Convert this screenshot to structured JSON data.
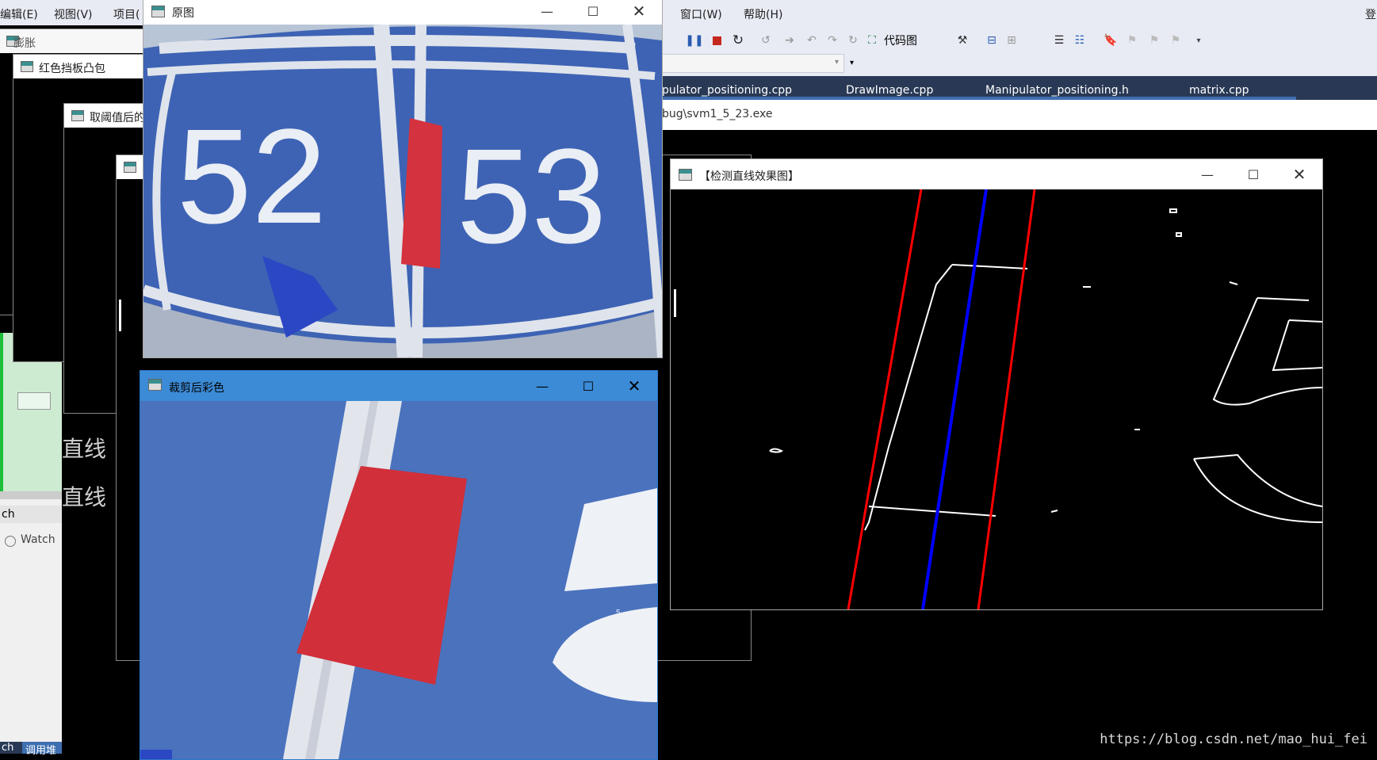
{
  "vs": {
    "menu": [
      "编辑(E)",
      "视图(V)",
      "项目(",
      "窗口(W)",
      "帮助(H)",
      "登"
    ],
    "toolbar": {
      "codemap_label": "代码图",
      "icons": [
        "pause-icon",
        "stop-icon",
        "restart-icon",
        "step-icon",
        "bookmark-icon"
      ]
    },
    "tabs": [
      "pulator_positioning.cpp",
      "DrawImage.cpp",
      "Manipulator_positioning.h",
      "matrix.cpp"
    ],
    "path": "bug\\svm1_5_23.exe",
    "left_panel": {
      "label1": "ch",
      "watch": "Watch",
      "bottom_tab_a": "ch",
      "bottom_tab_b": "调用堆"
    }
  },
  "windows": {
    "dilate": {
      "title": "膨胀"
    },
    "convex": {
      "title": "红色挡板凸包"
    },
    "threshold": {
      "title": "取阈值后的"
    },
    "original": {
      "title": "原图",
      "numbers": [
        "52",
        "53"
      ]
    },
    "cropped": {
      "title": "裁剪后彩色",
      "number_fragment": "5"
    },
    "lines": {
      "title": "【检测直线效果图】"
    }
  },
  "console": {
    "lines": [
      "直线",
      "直线"
    ]
  },
  "colors": {
    "road_blue": "#4a72bd",
    "red_marker": "#d12f3a",
    "line_red": "#ff0000",
    "line_blue": "#0000ff"
  },
  "watermark": "https://blog.csdn.net/mao_hui_fei"
}
